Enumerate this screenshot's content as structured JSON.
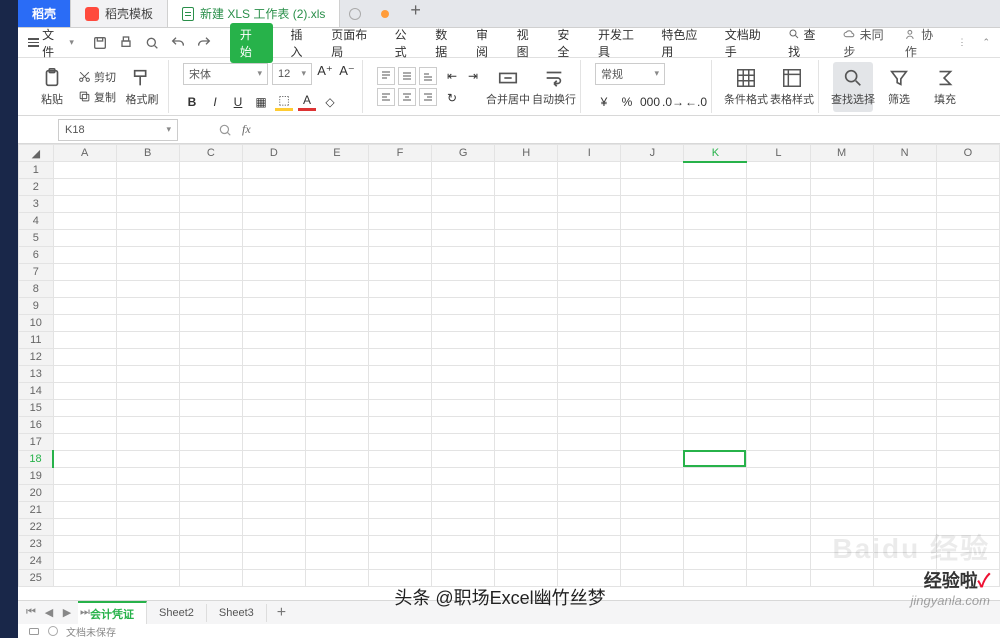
{
  "tabs": {
    "home": "稻壳",
    "second": "稻壳模板",
    "doc": "新建 XLS 工作表 (2).xls"
  },
  "menu": {
    "file": "文件",
    "items": [
      "开始",
      "插入",
      "页面布局",
      "公式",
      "数据",
      "审阅",
      "视图",
      "安全",
      "开发工具",
      "特色应用",
      "文档助手"
    ],
    "search": "查找",
    "unsync": "未同步",
    "coop": "协作"
  },
  "ribbon": {
    "paste": "粘贴",
    "cut": "剪切",
    "copy": "复制",
    "format_painter": "格式刷",
    "font_name": "宋体",
    "font_size": "12",
    "merge": "合并居中",
    "wrap": "自动换行",
    "number_format": "常规",
    "cond_format": "条件格式",
    "table_style": "表格样式",
    "find_select": "查找选择",
    "sort": "筛选",
    "fill": "填充"
  },
  "namebox": "K18",
  "columns": [
    "A",
    "B",
    "C",
    "D",
    "E",
    "F",
    "G",
    "H",
    "I",
    "J",
    "K",
    "L",
    "M",
    "N",
    "O"
  ],
  "active_col_index": 10,
  "rows": [
    "1",
    "2",
    "3",
    "4",
    "5",
    "6",
    "7",
    "8",
    "9",
    "10",
    "11",
    "12",
    "13",
    "14",
    "15",
    "16",
    "17",
    "18",
    "19",
    "20",
    "21",
    "22",
    "23",
    "24",
    "25"
  ],
  "active_row_index": 17,
  "sheet_tabs": {
    "active": "会计凭证",
    "others": [
      "Sheet2",
      "Sheet3"
    ]
  },
  "status": "文档未保存",
  "watermark_big": "Baidu 经验",
  "watermark_brand": "经验啦",
  "watermark_url": "jingyanla.com",
  "headline": "头条 @职场Excel幽竹丝梦"
}
